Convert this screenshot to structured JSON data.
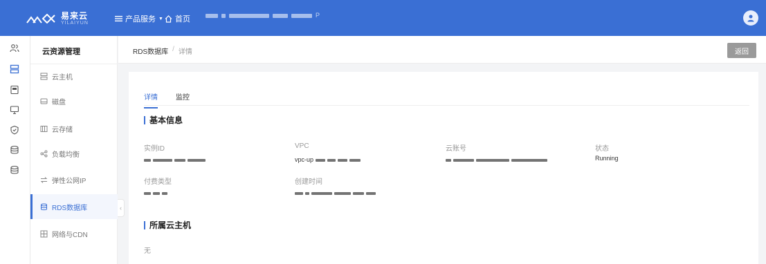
{
  "topbar": {
    "logo_text": "易来云",
    "logo_sub": "YILAIYUN",
    "products_label": "产品服务",
    "home_label": "首页",
    "account_info_tail": "P"
  },
  "rail": [
    "user-group-icon",
    "server-stack-icon",
    "calculator-icon",
    "monitor-icon",
    "shield-icon",
    "database-icon",
    "database-alt-icon"
  ],
  "subnav": {
    "title": "云资源管理",
    "items": [
      {
        "label": "云主机",
        "icon": "server-icon"
      },
      {
        "label": "磁盘",
        "icon": "disk-icon"
      },
      {
        "label": "云存储",
        "icon": "storage-icon"
      },
      {
        "label": "负载均衡",
        "icon": "share-icon"
      },
      {
        "label": "弹性公网IP",
        "icon": "swap-icon"
      },
      {
        "label": "RDS数据库",
        "icon": "database-icon",
        "active": true
      },
      {
        "label": "网络与CDN",
        "icon": "network-icon"
      }
    ]
  },
  "breadcrumb": {
    "parent": "RDS数据库",
    "sep": "/",
    "current": "详情"
  },
  "back_label": "返回",
  "tabs": [
    {
      "label": "详情",
      "active": true
    },
    {
      "label": "监控"
    }
  ],
  "basic_info": {
    "title": "基本信息",
    "fields": [
      {
        "label": "实例ID",
        "value": ""
      },
      {
        "label": "VPC",
        "value": "vpc-up"
      },
      {
        "label": "云账号",
        "value": ""
      },
      {
        "label": "状态",
        "value": "Running"
      },
      {
        "label": "付费类型",
        "value": ""
      },
      {
        "label": "创建时间",
        "value": ""
      }
    ]
  },
  "host_section": {
    "title": "所属云主机",
    "text": "无"
  },
  "colors": {
    "primary": "#3a6fd4",
    "back_button": "#9a9a9a"
  }
}
